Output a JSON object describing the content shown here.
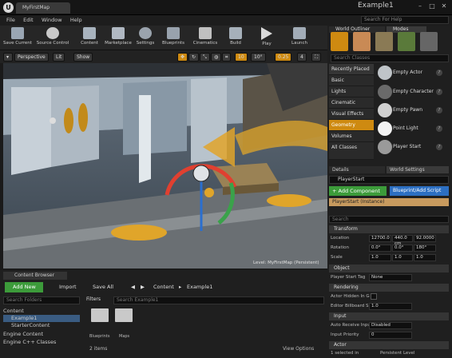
{
  "window": {
    "tab_title": "MyFirstMap",
    "title": "Example1",
    "search_help": "Search For Help"
  },
  "menu": [
    "File",
    "Edit",
    "Window",
    "Help"
  ],
  "toolbar": [
    {
      "label": "Save Current",
      "icon": "save-icon",
      "color": "#9aa6b3"
    },
    {
      "label": "Source Control",
      "icon": "source-control-icon",
      "color": "#c9c9c9"
    },
    {
      "label": "Content",
      "icon": "content-icon",
      "color": "#a8b3be"
    },
    {
      "label": "Marketplace",
      "icon": "marketplace-icon",
      "color": "#b0b8c2"
    },
    {
      "label": "Settings",
      "icon": "settings-icon",
      "color": "#9aa3ad"
    },
    {
      "label": "Blueprints",
      "icon": "blueprints-icon",
      "color": "#98a2ad"
    },
    {
      "label": "Cinematics",
      "icon": "cinematics-icon",
      "color": "#c0c0c0"
    },
    {
      "label": "Build",
      "icon": "build-icon",
      "color": "#a6b0ba"
    },
    {
      "label": "Play",
      "icon": "play-icon",
      "color": "#d9d9d9"
    },
    {
      "label": "Launch",
      "icon": "launch-icon",
      "color": "#a2acb7"
    }
  ],
  "viewport": {
    "perspective": "Perspective",
    "lit": "Lit",
    "show": "Show",
    "snap1": "10",
    "snap2": "10°",
    "scale": "0.25",
    "camera": "4",
    "level_label": "Level: MyFirstMap (Persistent)"
  },
  "world": {
    "outliner_tab": "World Outliner",
    "modes_tab": "Modes",
    "search_classes": "Search Classes"
  },
  "categories": [
    "Recently Placed",
    "Basic",
    "Lights",
    "Cinematic",
    "Visual Effects",
    "Geometry",
    "Volumes",
    "All Classes"
  ],
  "placeables": [
    "Empty Actor",
    "Empty Character",
    "Empty Pawn",
    "Point Light",
    "Player Start"
  ],
  "details": {
    "details_tab": "Details",
    "world_settings_tab": "World Settings",
    "actor_name": "PlayerStart",
    "add_component": "+ Add Component",
    "blueprint": "Blueprint/Add Script",
    "search": "Search",
    "instance": "PlayerStart (Instance)",
    "transform": "Transform",
    "location": "Location",
    "rotation": "Rotation",
    "scale": "Scale",
    "loc": [
      "12700.0",
      "440.0 cm",
      "92.0000"
    ],
    "rot": [
      "0.0°",
      "0.0°",
      "180°"
    ],
    "scl": [
      "1.0",
      "1.0",
      "1.0"
    ],
    "object": "Object",
    "player_start_tag": "Player Start Tag",
    "tag_value": "None",
    "rendering": "Rendering",
    "actor_hidden": "Actor Hidden In G",
    "editor_billboard": "Editor Billboard S",
    "billboard_value": "1.0",
    "input": "Input",
    "auto_receive": "Auto Receive Input",
    "auto_receive_value": "Disabled",
    "input_priority": "Input Priority",
    "priority_value": "0",
    "actor": "Actor",
    "selected": "1 selected in",
    "persistent": "Persistent Level"
  },
  "content_browser": {
    "tab": "Content Browser",
    "add_new": "Add New",
    "import": "Import",
    "save_all": "Save All",
    "path": [
      "Content",
      "Example1"
    ],
    "search_folders": "Search Folders",
    "filters": "Filters",
    "search_asset": "Search Example1",
    "tree": [
      "Content",
      "Example1",
      "StarterContent",
      "Engine Content",
      "Engine C++ Classes"
    ],
    "folders": [
      "Blueprints",
      "Maps"
    ],
    "count": "2 items",
    "view_options": "View Options"
  },
  "colors": {
    "accent": "#ce8a11",
    "add_green": "#3c9b3a",
    "blueprint_blue": "#2c6fc2",
    "sky": "#6e8296"
  }
}
